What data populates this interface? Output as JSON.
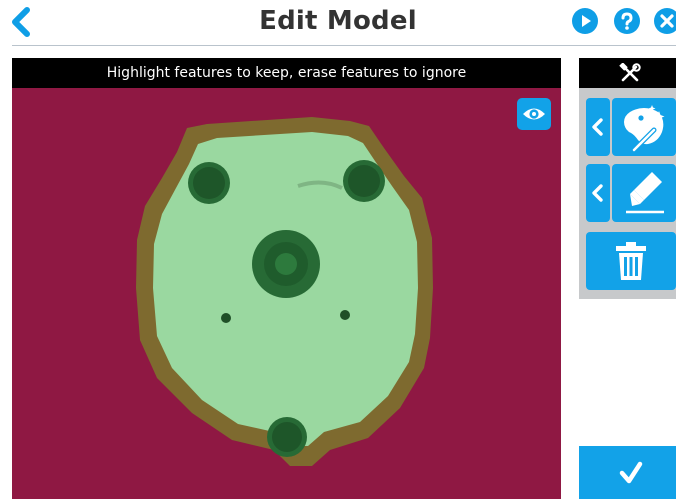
{
  "header": {
    "title": "Edit Model",
    "icons": [
      "back-chevron-icon",
      "play-icon",
      "help-icon",
      "close-icon"
    ]
  },
  "editor": {
    "instruction": "Highlight features to keep, erase features to ignore",
    "visibility_icon": "eye-icon"
  },
  "toolbar": {
    "header_icon": "tools-icon",
    "tools": [
      "magic-paint-icon",
      "highlighter-icon",
      "trash-icon"
    ],
    "confirm_icon": "checkmark-icon"
  },
  "colors": {
    "accent": "#12a2e8",
    "background_surface": "#8f1843",
    "highlight": "#9ad8a0",
    "toolbar_bg": "#c7c9cb"
  }
}
